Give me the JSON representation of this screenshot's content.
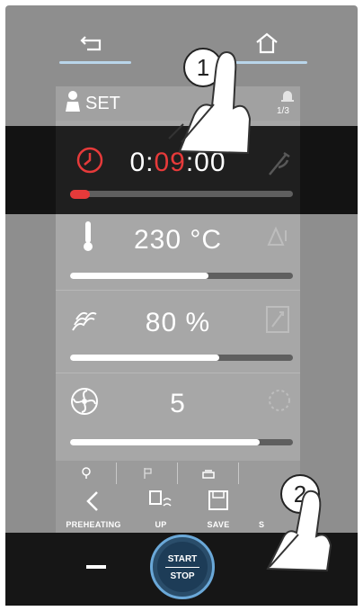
{
  "nav": {
    "back_icon": "back-arrow-icon",
    "home_icon": "home-icon",
    "lines": [
      "blue-underline"
    ]
  },
  "header": {
    "label": "SET",
    "page_count": "1/3"
  },
  "rows": {
    "time": {
      "prefix": "0:",
      "highlight": "09",
      "suffix": ":00",
      "progress": 0.04
    },
    "temperature": {
      "value": "230 °C",
      "progress": 0.62
    },
    "humidity": {
      "value": "80 %",
      "progress": 0.67
    },
    "fan": {
      "value": "5",
      "progress": 0.85
    }
  },
  "functions": [
    {
      "label": "PREHEATING"
    },
    {
      "label": "UP"
    },
    {
      "label": "SAVE"
    },
    {
      "label": "S"
    }
  ],
  "controls": {
    "start_label": "START",
    "stop_label": "STOP"
  },
  "callouts": {
    "one": "1",
    "two": "2"
  },
  "colors": {
    "accent_red": "#e63a3a",
    "accent_blue": "#6aa8d8",
    "nav_line": "#b9d5ea"
  }
}
